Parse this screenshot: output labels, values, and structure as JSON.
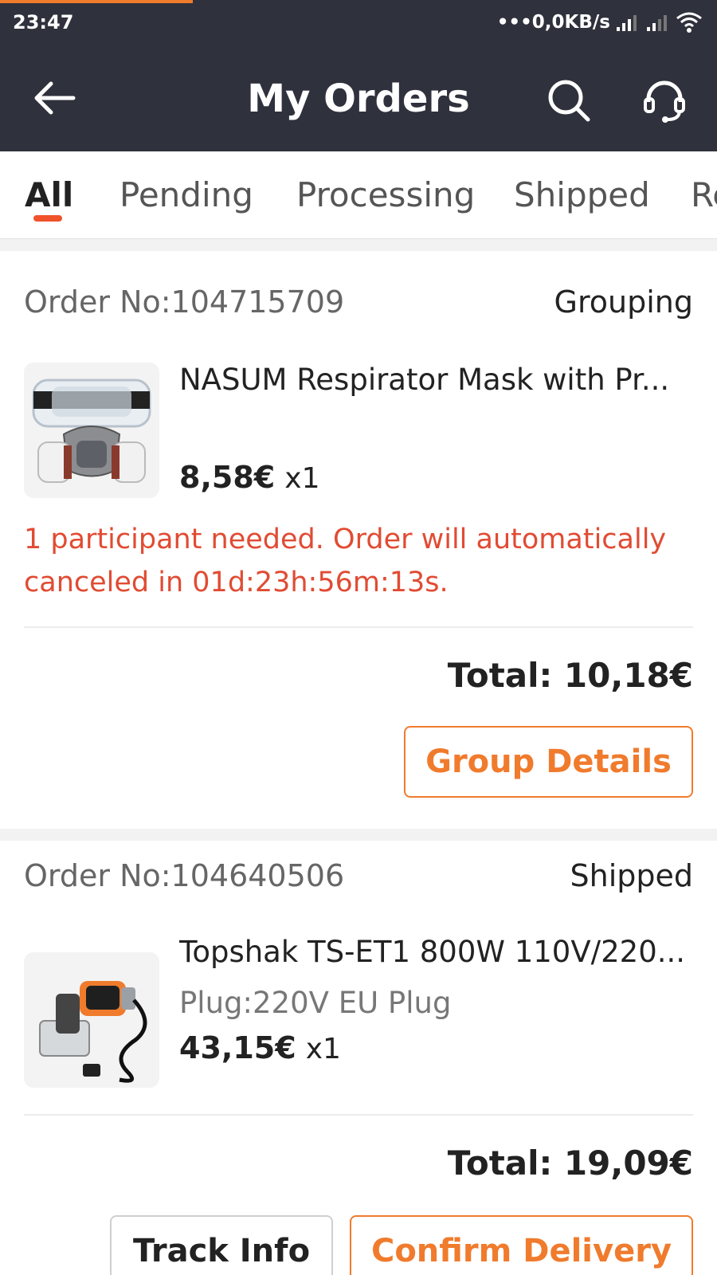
{
  "status_bar": {
    "time": "23:47",
    "network_speed": "•••0,0KB/s"
  },
  "header": {
    "title": "My Orders",
    "back_icon": "arrow-left-icon",
    "search_icon": "search-icon",
    "support_icon": "headset-icon"
  },
  "tabs": [
    {
      "label": "All",
      "active": true
    },
    {
      "label": "Pending",
      "active": false
    },
    {
      "label": "Processing",
      "active": false
    },
    {
      "label": "Shipped",
      "active": false
    },
    {
      "label": "Re",
      "active": false
    }
  ],
  "orders": [
    {
      "order_no": "Order No:104715709",
      "status": "Grouping",
      "product_name": "NASUM Respirator Mask with Pr...",
      "price": "8,58€",
      "quantity": "x1",
      "notice": "1 participant needed. Order will automatically canceled in 01d:23h:56m:13s.",
      "total": "Total: 10,18€",
      "buttons": [
        "Group Details"
      ]
    },
    {
      "order_no": "Order No:104640506",
      "status": "Shipped",
      "product_name": "Topshak TS-ET1 800W 110V/220...",
      "variant": "Plug:220V EU Plug",
      "price": "43,15€",
      "quantity": "x1",
      "total": "Total: 19,09€",
      "buttons": [
        "Track Info",
        "Confirm Delivery"
      ]
    }
  ],
  "colors": {
    "header_bg": "#2f313c",
    "accent": "#f07b2d",
    "alert": "#e14b33",
    "tab_indicator": "#f0522c"
  }
}
